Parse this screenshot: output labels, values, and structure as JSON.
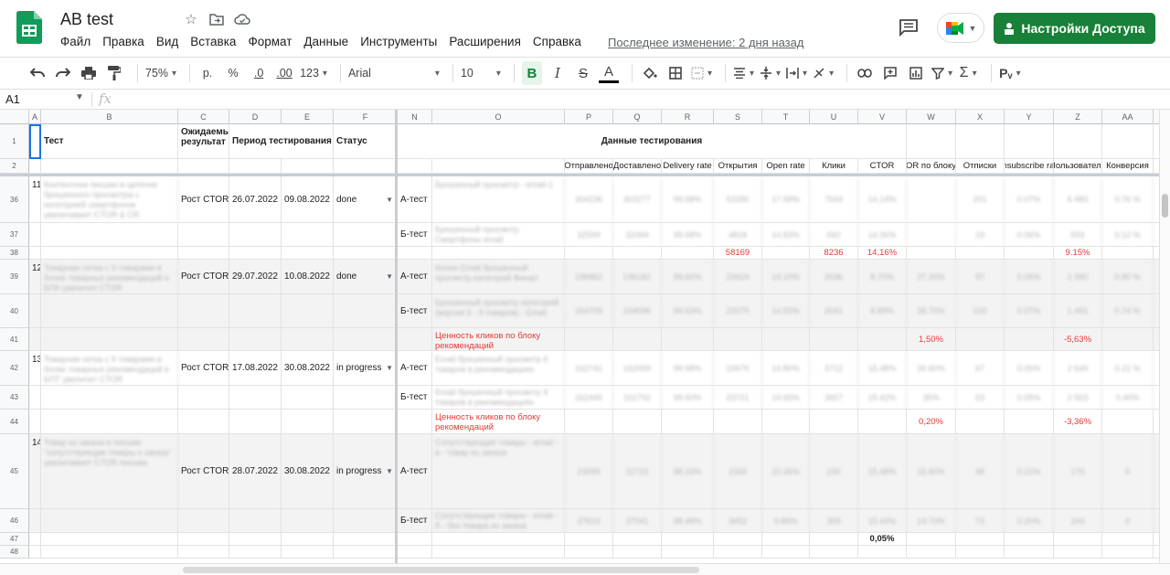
{
  "app": {
    "title": "AB test",
    "menu": [
      "Файл",
      "Правка",
      "Вид",
      "Вставка",
      "Формат",
      "Данные",
      "Инструменты",
      "Расширения",
      "Справка"
    ],
    "last_edit": "Последнее изменение: 2 дня назад",
    "share_label": "Настройки Доступа",
    "brand_color": "#188038"
  },
  "toolbar": {
    "zoom": "75%",
    "currency": "р.",
    "percent": "%",
    "dec_less": ".0",
    "dec_more": ".00",
    "number_format": "123",
    "font": "Arial",
    "font_size": "10",
    "bold": "B",
    "italic": "I",
    "strike": "S",
    "text_color": "A"
  },
  "formula": {
    "cell_ref": "A1",
    "fx": "fx"
  },
  "columns": [
    "A",
    "B",
    "C",
    "D",
    "E",
    "F",
    "N",
    "O",
    "P",
    "Q",
    "R",
    "S",
    "T",
    "U",
    "V",
    "W",
    "X",
    "Y",
    "Z",
    "AA"
  ],
  "header_rows": {
    "row1": {
      "num": "1",
      "test": "Тест",
      "expected": "Ожидаемый результат",
      "period": "Период тестирования",
      "status": "Статус",
      "data": "Данные тестирования"
    },
    "row2": {
      "num": "2",
      "metrics": [
        "Отправлено",
        "Доставлено",
        "Delivery rate",
        "Открытия",
        "Open rate",
        "Клики",
        "CTOR",
        "OR по блоку",
        "Отписки",
        "Unsubscribe rate",
        "Пользователи",
        "Конверсия"
      ]
    }
  },
  "rows": [
    {
      "num": "36",
      "id": "11",
      "test": "Контентное письмо в цепочке брошенного просмотра с категорией смартфонов увеличивает CTOR & CR",
      "expected": "Рост CTOR",
      "start": "26.07.2022",
      "end": "09.08.2022",
      "status": "done",
      "variant": "А-тест",
      "name": "Брошенный просмотр - email-1",
      "vals": [
        "304236",
        "303277",
        "99.68%",
        "53330",
        "17.58%",
        "7544",
        "14.14%",
        "",
        "201",
        "0.07%",
        "6 483",
        "0.76 %"
      ]
    },
    {
      "num": "37",
      "variant": "Б-тест",
      "name": "Брошенный просмотр Смартфоны email",
      "vals": [
        "32599",
        "32494",
        "99.68%",
        "4818",
        "14.83%",
        "692",
        "14.36%",
        "",
        "19",
        "0.06%",
        "593",
        "0.12 %"
      ]
    },
    {
      "num": "38",
      "totals": {
        "S": "58169",
        "U": "8236",
        "V": "14,16%",
        "Z": "9.15%"
      }
    },
    {
      "num": "39",
      "id": "12",
      "test": "Товарная сетка с 9 товарами в блоке товарных рекомендаций в БПК увеличит CTOR",
      "expected": "Рост CTOR",
      "start": "29.07.2022",
      "end": "10.08.2022",
      "status": "done",
      "variant": "А-тест",
      "name": "Копия Email брошенный просмотр категорий Финал",
      "vals": [
        "196862",
        "196181",
        "99.65%",
        "23424",
        "14.10%",
        "2036",
        "8.70%",
        "27.20%",
        "97",
        "0.06%",
        "1 580",
        "0.80 %"
      ]
    },
    {
      "num": "40",
      "variant": "Б-тест",
      "name": "Брошенный просмотр категорий (версия 6 - 9 товаров) - Email",
      "vals": [
        "164709",
        "164096",
        "99.63%",
        "22075",
        "14.55%",
        "2041",
        "8.89%",
        "28.70%",
        "120",
        "0.07%",
        "1 491",
        "0.74 %"
      ]
    },
    {
      "num": "41",
      "note": "Ценность кликов по блоку рекомендаций",
      "W": "1,50%",
      "Z": "-5,63%"
    },
    {
      "num": "42",
      "id": "13",
      "test": "Товарная сетка с 9 товарами в блоке товарных рекомендаций в БПТ увеличит CTOR",
      "expected": "Рост CTOR",
      "start": "17.08.2022",
      "end": "30.08.2022",
      "status": "in progress",
      "variant": "А-тест",
      "name": "Email брошенный просмотр 6 товаров в рекомендациях",
      "vals": [
        "162741",
        "162059",
        "99.58%",
        "23976",
        "14.80%",
        "3712",
        "15.48%",
        "34.60%",
        "67",
        "0.05%",
        "2 649",
        "0.21 %"
      ]
    },
    {
      "num": "43",
      "variant": "Б-тест",
      "name": "Email брошенный просмотр 9 товаров в рекомендациях",
      "vals": [
        "162445",
        "161792",
        "99.60%",
        "23721",
        "14.65%",
        "3657",
        "15.42%",
        "35%",
        "63",
        "0.05%",
        "2 563",
        "0.40%"
      ]
    },
    {
      "num": "44",
      "note": "Ценность кликов по блоку рекомендаций",
      "W": "0,20%",
      "Z": "-3,36%"
    },
    {
      "num": "45",
      "id": "14",
      "test": "Товар из заказа в письме \"сопутствующие товары к заказу\" увеличивает CTOR письма",
      "expected": "Рост CTOR",
      "start": "28.07.2022",
      "end": "30.08.2022",
      "status": "in progress",
      "variant": "А-тест",
      "name": "Сопутствующие товары - email - a - товар из заказа",
      "vals": [
        "23099",
        "22715",
        "98.33%",
        "2330",
        "10.26%",
        "230",
        "15.48%",
        "15.60%",
        "48",
        "0.21%",
        "170",
        "0"
      ]
    },
    {
      "num": "46",
      "variant": "Б-тест",
      "name": "Сопутствующие товары - email - б - без товара из заказа",
      "vals": [
        "37613",
        "37041",
        "98.48%",
        "3652",
        "9.86%",
        "309",
        "15.43%",
        "14.70%",
        "73",
        "0.20%",
        "244",
        "0"
      ]
    },
    {
      "num": "47",
      "V": "0,05%"
    },
    {
      "num": "48"
    }
  ]
}
